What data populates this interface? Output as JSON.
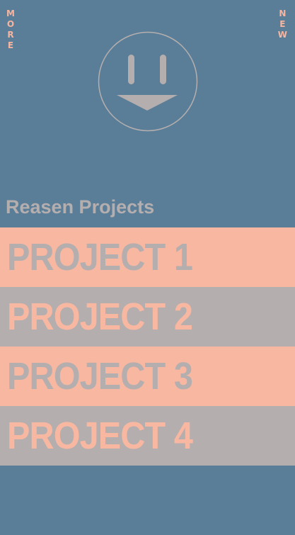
{
  "nav": {
    "more_letters": [
      "M",
      "O",
      "R",
      "E"
    ],
    "new_letters": [
      "N",
      "E",
      "W"
    ]
  },
  "logo": {
    "icon": "smiley-face-icon"
  },
  "section": {
    "title": "Reasen Projects"
  },
  "projects": [
    {
      "label": "PROJECT 1"
    },
    {
      "label": "PROJECT 2"
    },
    {
      "label": "PROJECT 3"
    },
    {
      "label": "PROJECT 4"
    }
  ],
  "colors": {
    "background": "#5a7e98",
    "salmon": "#f8b7a1",
    "gray": "#b5aeae"
  }
}
